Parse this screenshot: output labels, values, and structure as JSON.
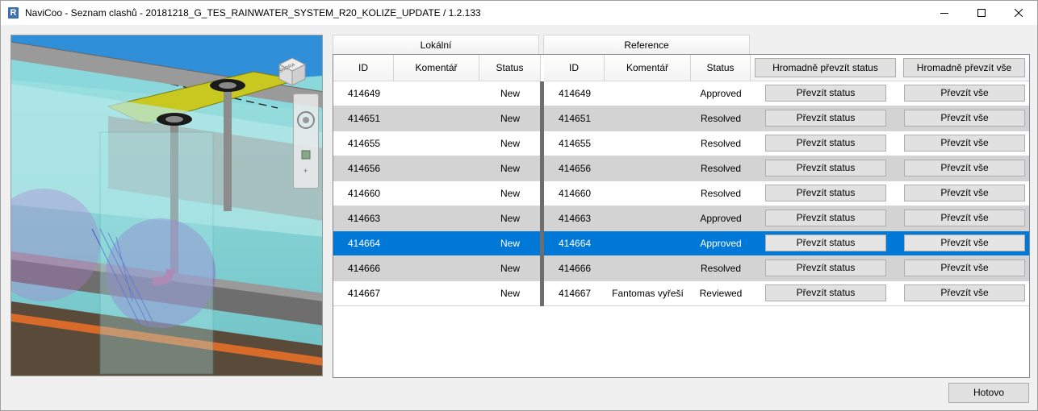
{
  "window": {
    "app_icon_letter": "R",
    "title": "NaviCoo - Seznam clashů - 20181218_G_TES_RAINWATER_SYSTEM_R20_KOLIZE_UPDATE / 1.2.133"
  },
  "viewcube": {
    "face_label": "SHORA"
  },
  "groups": {
    "local": "Lokální",
    "reference": "Reference"
  },
  "columns": {
    "local_id": "ID",
    "local_comment": "Komentář",
    "local_status": "Status",
    "ref_id": "ID",
    "ref_comment": "Komentář",
    "ref_status": "Status"
  },
  "header_buttons": {
    "bulk_status": "Hromadně převzít status",
    "bulk_all": "Hromadně převzít vše"
  },
  "row_buttons": {
    "take_status": "Převzít status",
    "take_all": "Převzít vše"
  },
  "rows": [
    {
      "local_id": "414649",
      "local_comment": "",
      "local_status": "New",
      "ref_id": "414649",
      "ref_comment": "",
      "ref_status": "Approved"
    },
    {
      "local_id": "414651",
      "local_comment": "",
      "local_status": "New",
      "ref_id": "414651",
      "ref_comment": "",
      "ref_status": "Resolved"
    },
    {
      "local_id": "414655",
      "local_comment": "",
      "local_status": "New",
      "ref_id": "414655",
      "ref_comment": "",
      "ref_status": "Resolved"
    },
    {
      "local_id": "414656",
      "local_comment": "",
      "local_status": "New",
      "ref_id": "414656",
      "ref_comment": "",
      "ref_status": "Resolved"
    },
    {
      "local_id": "414660",
      "local_comment": "",
      "local_status": "New",
      "ref_id": "414660",
      "ref_comment": "",
      "ref_status": "Resolved"
    },
    {
      "local_id": "414663",
      "local_comment": "",
      "local_status": "New",
      "ref_id": "414663",
      "ref_comment": "",
      "ref_status": "Approved"
    },
    {
      "local_id": "414664",
      "local_comment": "",
      "local_status": "New",
      "ref_id": "414664",
      "ref_comment": "",
      "ref_status": "Approved",
      "selected": true
    },
    {
      "local_id": "414666",
      "local_comment": "",
      "local_status": "New",
      "ref_id": "414666",
      "ref_comment": "",
      "ref_status": "Resolved"
    },
    {
      "local_id": "414667",
      "local_comment": "",
      "local_status": "New",
      "ref_id": "414667",
      "ref_comment": "Fantomas vyřeší",
      "ref_status": "Reviewed"
    }
  ],
  "footer": {
    "done_label": "Hotovo"
  },
  "colors": {
    "selection": "#0078d7",
    "alt_row": "#d3d3d3",
    "divider": "#6d6d6d"
  }
}
